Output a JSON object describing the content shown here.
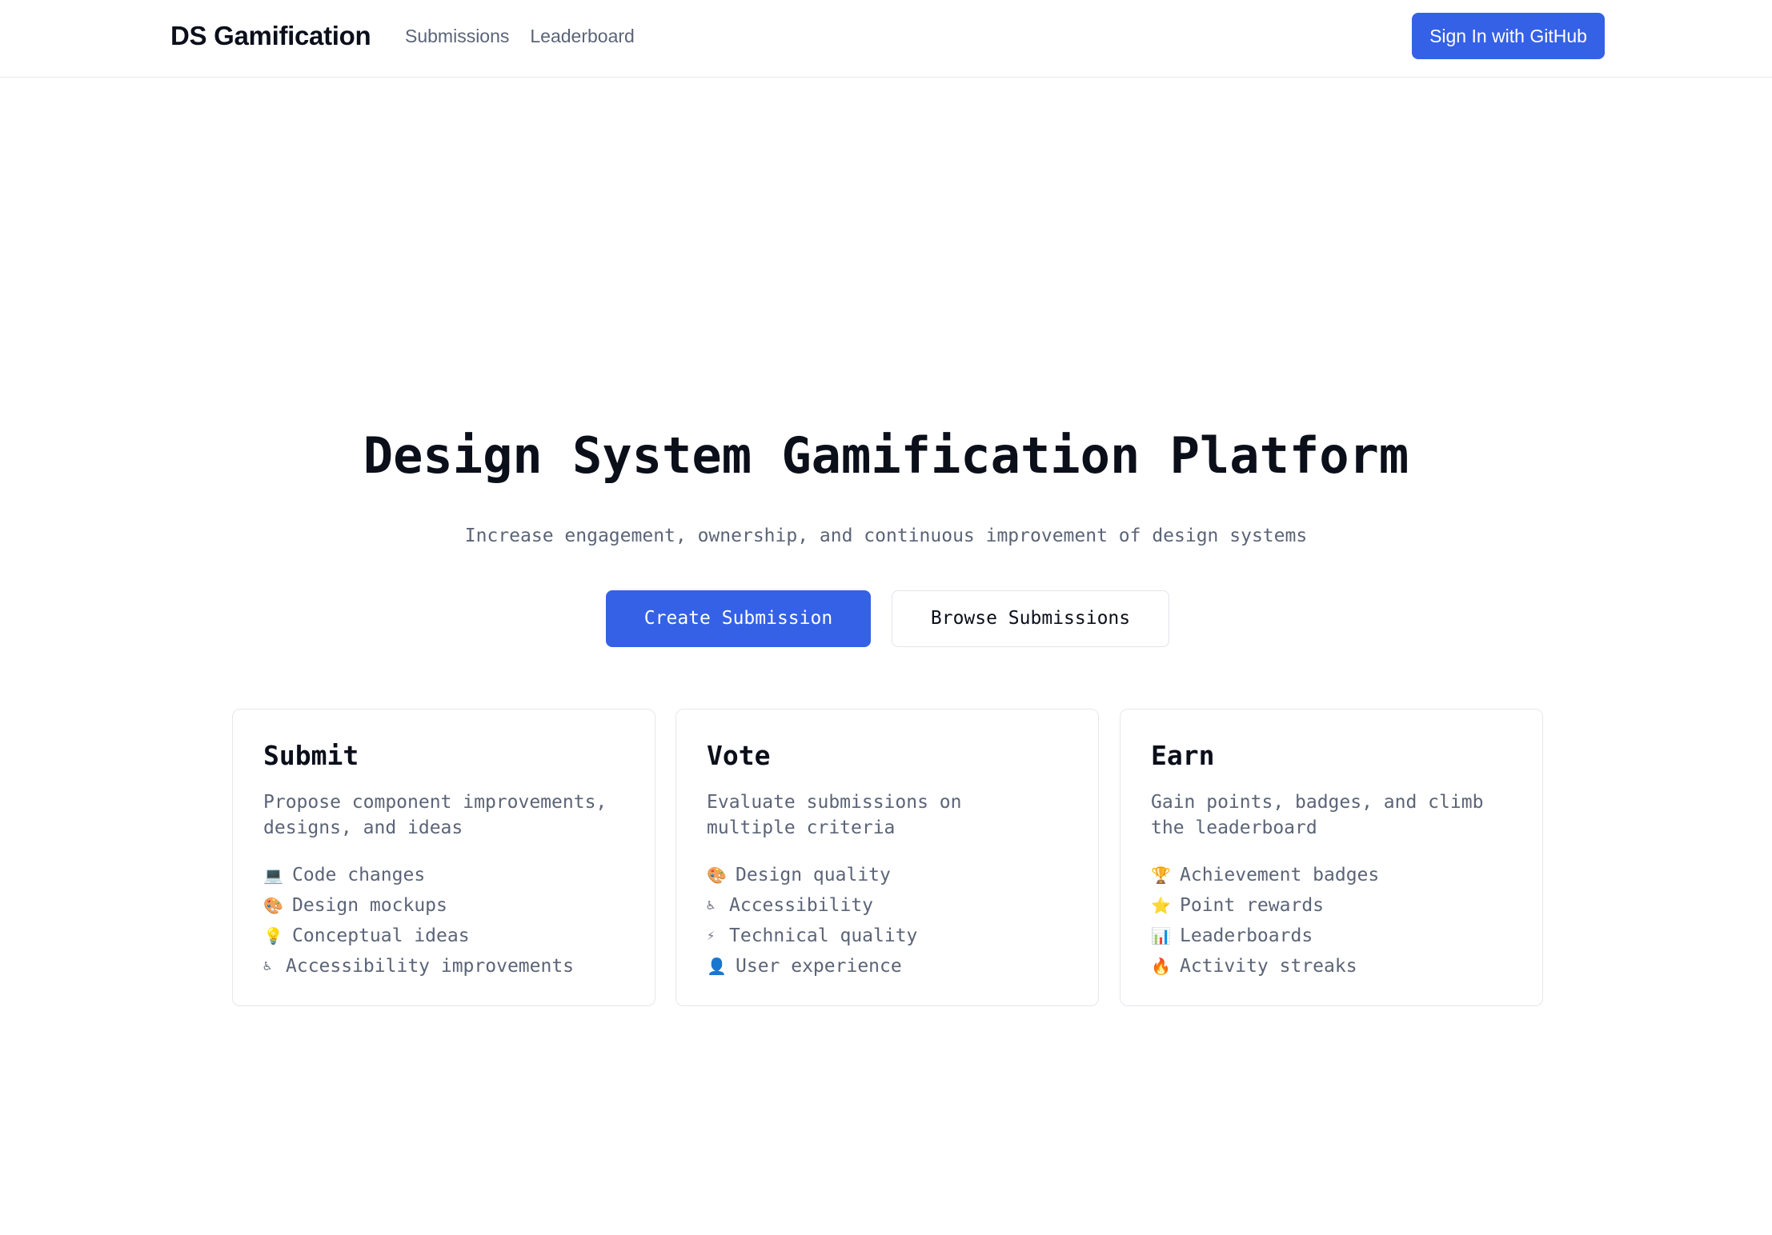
{
  "header": {
    "brand": "DS Gamification",
    "nav": [
      {
        "label": "Submissions"
      },
      {
        "label": "Leaderboard"
      }
    ],
    "signin_label": "Sign In with GitHub"
  },
  "hero": {
    "title": "Design System Gamification Platform",
    "subtitle": "Increase engagement, ownership, and continuous improvement of design systems",
    "primary_cta": "Create Submission",
    "secondary_cta": "Browse Submissions"
  },
  "cards": [
    {
      "title": "Submit",
      "description": "Propose component improvements, designs, and ideas",
      "features": [
        {
          "icon": "laptop-icon",
          "glyph": "💻",
          "label": "Code changes"
        },
        {
          "icon": "palette-icon",
          "glyph": "🎨",
          "label": "Design mockups"
        },
        {
          "icon": "lightbulb-icon",
          "glyph": "💡",
          "label": "Conceptual ideas"
        },
        {
          "icon": "accessibility-icon",
          "glyph": "♿",
          "label": "Accessibility improvements"
        }
      ]
    },
    {
      "title": "Vote",
      "description": "Evaluate submissions on multiple criteria",
      "features": [
        {
          "icon": "palette-icon",
          "glyph": "🎨",
          "label": "Design quality"
        },
        {
          "icon": "accessibility-icon",
          "glyph": "♿",
          "label": "Accessibility"
        },
        {
          "icon": "lightning-icon",
          "glyph": "⚡",
          "label": "Technical quality"
        },
        {
          "icon": "user-icon",
          "glyph": "👤",
          "label": "User experience"
        }
      ]
    },
    {
      "title": "Earn",
      "description": "Gain points, badges, and climb the leaderboard",
      "features": [
        {
          "icon": "trophy-icon",
          "glyph": "🏆",
          "label": "Achievement badges"
        },
        {
          "icon": "star-icon",
          "glyph": "⭐",
          "label": "Point rewards"
        },
        {
          "icon": "bar-chart-icon",
          "glyph": "📊",
          "label": "Leaderboards"
        },
        {
          "icon": "fire-icon",
          "glyph": "🔥",
          "label": "Activity streaks"
        }
      ]
    }
  ],
  "colors": {
    "accent": "#3561e6",
    "text_primary": "#0b0f1a",
    "text_muted": "#5b6477",
    "border": "#e5e7eb"
  }
}
